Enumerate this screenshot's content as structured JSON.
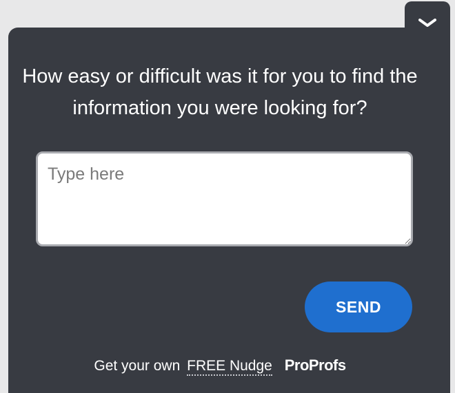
{
  "widget": {
    "question": "How easy or difficult was it for you to find the information you were looking for?",
    "input_placeholder": "Type here",
    "input_value": "",
    "send_label": "SEND",
    "toggle_icon": "chevron-down-icon"
  },
  "footer": {
    "prefix": "Get your own",
    "link_text": "FREE Nudge",
    "brand": "ProProfs"
  },
  "colors": {
    "panel_bg": "#383b42",
    "page_bg": "#e8e8e9",
    "button_bg": "#1f6fcf",
    "text": "#ffffff"
  }
}
